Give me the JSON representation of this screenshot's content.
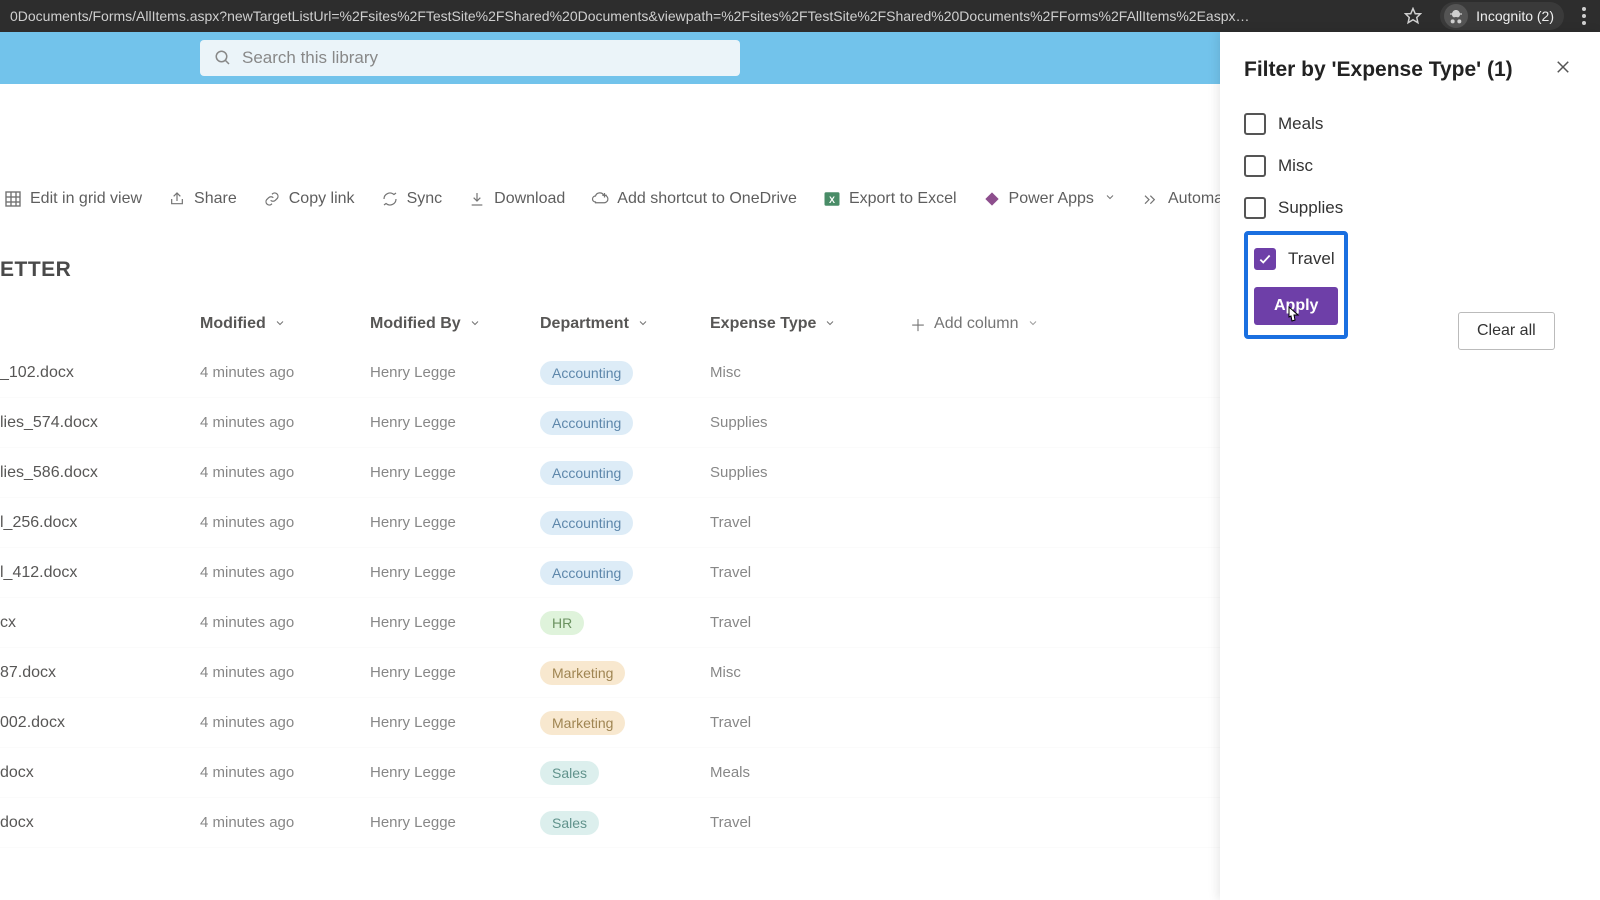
{
  "browser": {
    "url": "0Documents/Forms/AllItems.aspx?newTargetListUrl=%2Fsites%2FTestSite%2FShared%20Documents&viewpath=%2Fsites%2FTestSite%2FShared%20Documents%2FForms%2FAllItems%2Easpx…",
    "incognito_label": "Incognito (2)"
  },
  "search": {
    "placeholder": "Search this library"
  },
  "commands": {
    "edit_grid": "Edit in grid view",
    "share": "Share",
    "copy_link": "Copy link",
    "sync": "Sync",
    "download": "Download",
    "add_shortcut": "Add shortcut to OneDrive",
    "export_excel": "Export to Excel",
    "power_apps": "Power Apps",
    "automate": "Automate"
  },
  "page": {
    "title_fragment": "ETTER"
  },
  "columns": {
    "modified": "Modified",
    "modified_by": "Modified By",
    "department": "Department",
    "expense_type": "Expense Type",
    "add_column": "Add column"
  },
  "rows": [
    {
      "name": "_102.docx",
      "modified": "4 minutes ago",
      "by": "Henry Legge",
      "dept": "Accounting",
      "dept_pill": "accounting",
      "etype": "Misc"
    },
    {
      "name": "lies_574.docx",
      "modified": "4 minutes ago",
      "by": "Henry Legge",
      "dept": "Accounting",
      "dept_pill": "accounting",
      "etype": "Supplies"
    },
    {
      "name": "lies_586.docx",
      "modified": "4 minutes ago",
      "by": "Henry Legge",
      "dept": "Accounting",
      "dept_pill": "accounting",
      "etype": "Supplies"
    },
    {
      "name": "l_256.docx",
      "modified": "4 minutes ago",
      "by": "Henry Legge",
      "dept": "Accounting",
      "dept_pill": "accounting",
      "etype": "Travel"
    },
    {
      "name": "l_412.docx",
      "modified": "4 minutes ago",
      "by": "Henry Legge",
      "dept": "Accounting",
      "dept_pill": "accounting",
      "etype": "Travel"
    },
    {
      "name": "cx",
      "modified": "4 minutes ago",
      "by": "Henry Legge",
      "dept": "HR",
      "dept_pill": "hr",
      "etype": "Travel"
    },
    {
      "name": "87.docx",
      "modified": "4 minutes ago",
      "by": "Henry Legge",
      "dept": "Marketing",
      "dept_pill": "marketing",
      "etype": "Misc"
    },
    {
      "name": "002.docx",
      "modified": "4 minutes ago",
      "by": "Henry Legge",
      "dept": "Marketing",
      "dept_pill": "marketing",
      "etype": "Travel"
    },
    {
      "name": "docx",
      "modified": "4 minutes ago",
      "by": "Henry Legge",
      "dept": "Sales",
      "dept_pill": "sales",
      "etype": "Meals"
    },
    {
      "name": "docx",
      "modified": "4 minutes ago",
      "by": "Henry Legge",
      "dept": "Sales",
      "dept_pill": "sales",
      "etype": "Travel"
    }
  ],
  "filter_panel": {
    "title": "Filter by 'Expense Type' (1)",
    "options": {
      "meals": "Meals",
      "misc": "Misc",
      "supplies": "Supplies",
      "travel": "Travel"
    },
    "apply": "Apply",
    "clear": "Clear all"
  }
}
